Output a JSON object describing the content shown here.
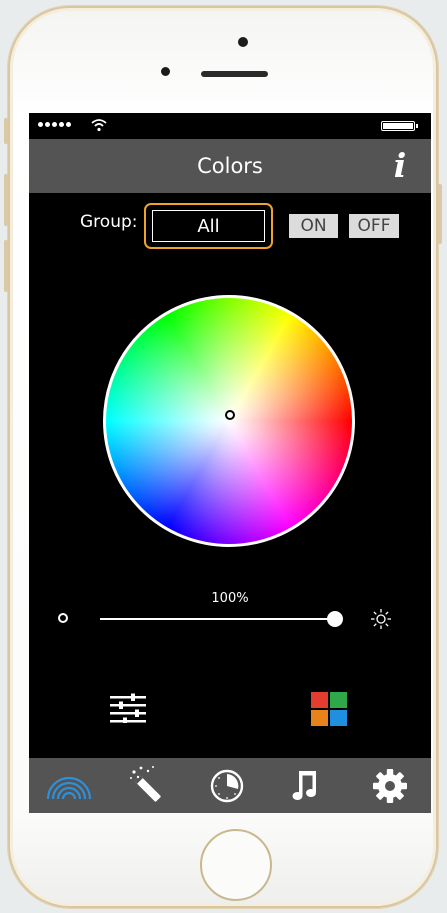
{
  "nav": {
    "title": "Colors",
    "info_glyph": "i"
  },
  "group": {
    "label": "Group:",
    "value": "All"
  },
  "power": {
    "on_label": "ON",
    "off_label": "OFF"
  },
  "brightness": {
    "label": "100%",
    "value": 100
  },
  "colors": {
    "accent": "#f0a22a",
    "bar": "#545454",
    "active_tab": "#2f8fd8",
    "palette": [
      "#e43c2f",
      "#2fa84a",
      "#e8831c",
      "#1f8fe0"
    ]
  },
  "icons": {
    "signal": "signal-dots-icon",
    "wifi": "wifi-icon",
    "battery": "battery-icon",
    "info": "info-icon",
    "dim": "dim-icon",
    "bright": "brightness-icon",
    "mixer": "mixer-icon",
    "palette": "palette-icon"
  },
  "tabs": [
    {
      "icon": "rainbow-icon",
      "active": true
    },
    {
      "icon": "magic-wand-icon",
      "active": false
    },
    {
      "icon": "timer-icon",
      "active": false
    },
    {
      "icon": "music-icon",
      "active": false
    },
    {
      "icon": "gear-icon",
      "active": false
    }
  ]
}
